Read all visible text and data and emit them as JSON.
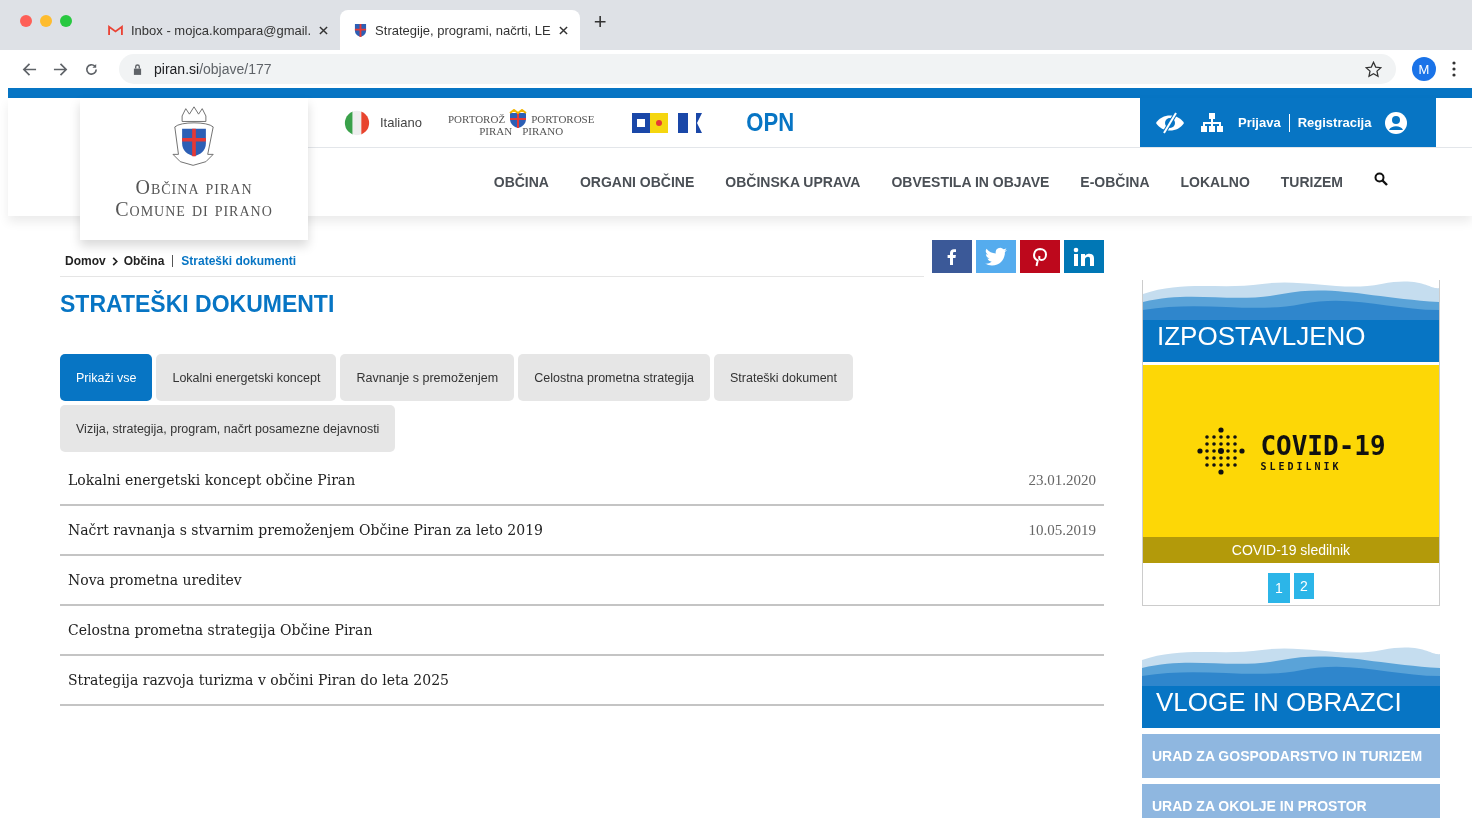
{
  "browser": {
    "tabs": [
      {
        "title": "Inbox - mojca.kompara@gmail.",
        "kind": "mail",
        "selected": false
      },
      {
        "title": "Strategije, programi, načrti, LE",
        "kind": "crest",
        "selected": true
      }
    ],
    "new_tab": "+",
    "url_host": "piran.si",
    "url_path": "/objave/177",
    "profile": "M"
  },
  "header": {
    "logo_line1": "Občina piran",
    "logo_line2": "Comune di pirano",
    "language": "Italiano",
    "tourism_logo": {
      "top_left": "PORTOROŽ",
      "top_right": "PORTOROSE",
      "bottom_left": "PIRAN",
      "bottom_right": "PIRANO"
    },
    "opn": "OPN",
    "login": "Prijava",
    "register": "Registracija"
  },
  "nav": [
    "OBČINA",
    "ORGANI OBČINE",
    "OBČINSKA UPRAVA",
    "OBVESTILA IN OBJAVE",
    "E-OBČINA",
    "LOKALNO",
    "TURIZEM"
  ],
  "breadcrumb": {
    "items": [
      "Domov",
      "Občina"
    ],
    "current": "Strateški dokumenti"
  },
  "title": "STRATEŠKI DOKUMENTI",
  "filters": [
    {
      "label": "Prikaži vse",
      "selected": true
    },
    {
      "label": "Lokalni energetski koncept",
      "selected": false
    },
    {
      "label": "Ravnanje s premoženjem",
      "selected": false
    },
    {
      "label": "Celostna prometna strategija",
      "selected": false
    },
    {
      "label": "Strateški dokument",
      "selected": false
    },
    {
      "label": "Vizija, strategija, program, načrt posamezne dejavnosti",
      "selected": false
    }
  ],
  "documents": [
    {
      "title": "Lokalni energetski koncept občine Piran",
      "date": "23.01.2020"
    },
    {
      "title": "Načrt ravnanja s stvarnim premoženjem Občine Piran za leto 2019",
      "date": "10.05.2019"
    },
    {
      "title": "Nova prometna ureditev"
    },
    {
      "title": "Celostna prometna strategija Občine Piran"
    },
    {
      "title": "Strategija razvoja turizma v občini Piran do leta 2025"
    }
  ],
  "featured": {
    "heading": "IZPOSTAVLJENO",
    "logo_title": "COVID-19",
    "logo_subtitle": "SLEDILNIK",
    "caption": "COVID-19 sledilnik",
    "pages": [
      {
        "label": "1",
        "selected": true
      },
      {
        "label": "2",
        "selected": false
      }
    ]
  },
  "forms": {
    "heading": "VLOGE IN OBRAZCI",
    "items": [
      "URAD ZA GOSPODARSTVO IN TURIZEM",
      "URAD ZA OKOLJE IN PROSTOR"
    ]
  }
}
